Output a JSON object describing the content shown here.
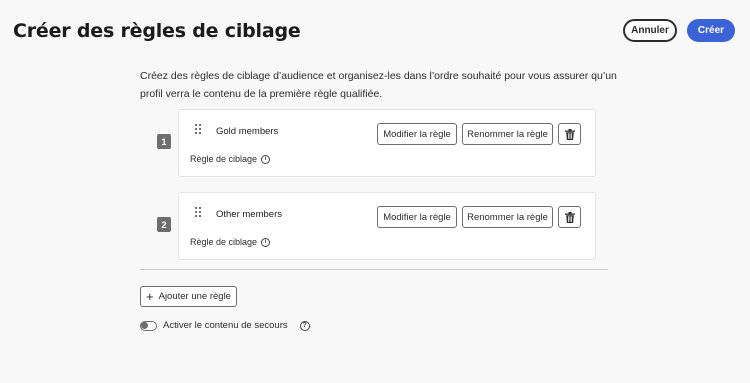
{
  "header": {
    "title": "Créer des règles de ciblage",
    "cancel_label": "Annuler",
    "create_label": "Créer"
  },
  "description": "Créez des règles de ciblage d’audience et organisez-les dans l’ordre souhaité pour vous assurer qu’un profil verra le contenu de la première règle qualifiée.",
  "rules": [
    {
      "index": "1",
      "name": "Gold members",
      "subtitle": "Règle de ciblage",
      "modify_label": "Modifier la règle",
      "rename_label": "Renommer la règle"
    },
    {
      "index": "2",
      "name": "Other members",
      "subtitle": "Règle de ciblage",
      "modify_label": "Modifier la règle",
      "rename_label": "Renommer la règle"
    }
  ],
  "add_rule_label": "Ajouter une règle",
  "fallback": {
    "label": "Activer le contenu de secours",
    "enabled": false
  },
  "colors": {
    "accent": "#3b63d6",
    "background": "#f8f8f8"
  },
  "icons": [
    "drag-handle-icon",
    "info-icon",
    "trash-icon",
    "plus-icon",
    "help-icon"
  ]
}
